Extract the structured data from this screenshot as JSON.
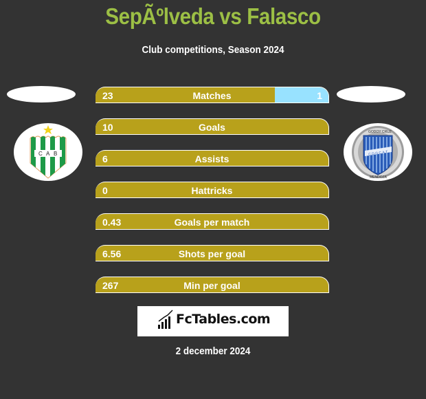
{
  "header": {
    "title": "SepÃºlveda vs Falasco",
    "subtitle": "Club competitions, Season 2024"
  },
  "players": {
    "left": {
      "badge": "banfield-crest",
      "badge_letters": "C A B"
    },
    "right": {
      "badge": "godoy-cruz-crest",
      "badge_top_text": "GODOY CRUZ",
      "badge_band_text": "C.D.G.C.A.T",
      "badge_bottom_text": "MENDOZA"
    }
  },
  "colors": {
    "background": "#333333",
    "title": "#9cbf45",
    "left_bar": "#b8a11b",
    "right_bar": "#98e2ff"
  },
  "stats": [
    {
      "label": "Matches",
      "left": "23",
      "right": "1",
      "right_share": 0.23
    },
    {
      "label": "Goals",
      "left": "10",
      "right": "",
      "right_share": 0
    },
    {
      "label": "Assists",
      "left": "6",
      "right": "",
      "right_share": 0
    },
    {
      "label": "Hattricks",
      "left": "0",
      "right": "",
      "right_share": 0
    },
    {
      "label": "Goals per match",
      "left": "0.43",
      "right": "",
      "right_share": 0
    },
    {
      "label": "Shots per goal",
      "left": "6.56",
      "right": "",
      "right_share": 0
    },
    {
      "label": "Min per goal",
      "left": "267",
      "right": "",
      "right_share": 0
    }
  ],
  "footer": {
    "brand": "FcTables.com",
    "date": "2 december 2024"
  }
}
